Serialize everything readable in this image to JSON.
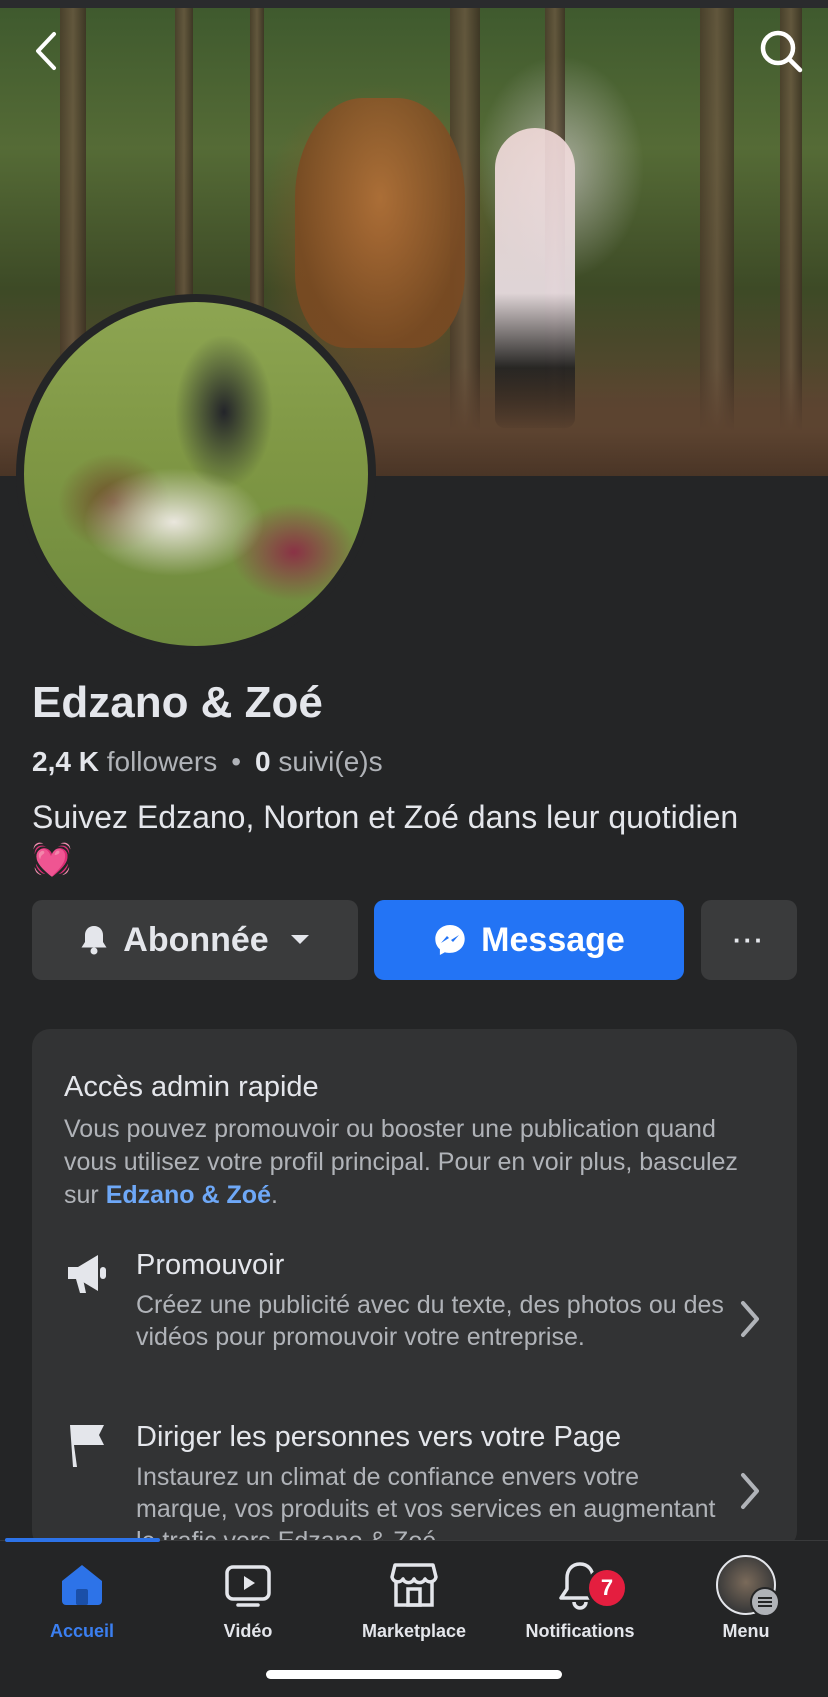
{
  "profile": {
    "name": "Edzano & Zoé",
    "followers_count": "2,4 K",
    "followers_label": "followers",
    "following_count": "0",
    "following_label": "suivi(e)s",
    "bio": "Suivez Edzano, Norton et Zoé dans leur quotidien",
    "bio_emoji": "💓"
  },
  "actions": {
    "follow_label": "Abonnée",
    "message_label": "Message",
    "more_label": "···"
  },
  "admin_card": {
    "title": "Accès admin rapide",
    "desc_prefix": "Vous pouvez promouvoir ou booster une publication quand vous utilisez votre profil principal. Pour en voir plus, basculez sur ",
    "desc_link": "Edzano & Zoé",
    "desc_suffix": ".",
    "items": [
      {
        "title": "Promouvoir",
        "desc": "Créez une publicité avec du texte, des photos ou des vidéos pour promouvoir votre entreprise.",
        "icon": "megaphone-icon"
      },
      {
        "title": "Diriger les personnes vers votre Page",
        "desc": "Instaurez un climat de confiance envers votre marque, vos produits et vos services en augmentant le trafic vers Edzano & Zoé",
        "icon": "flag-icon"
      }
    ]
  },
  "tabbar": {
    "tabs": [
      {
        "label": "Accueil",
        "icon": "home-icon",
        "active": true
      },
      {
        "label": "Vidéo",
        "icon": "video-icon"
      },
      {
        "label": "Marketplace",
        "icon": "marketplace-icon"
      },
      {
        "label": "Notifications",
        "icon": "bell-icon",
        "badge": "7"
      },
      {
        "label": "Menu",
        "icon": "profile-menu-icon"
      }
    ]
  },
  "colors": {
    "background": "#242526",
    "accent": "#2374f5",
    "link": "#6ea8f7",
    "badge": "#e41e3f"
  }
}
